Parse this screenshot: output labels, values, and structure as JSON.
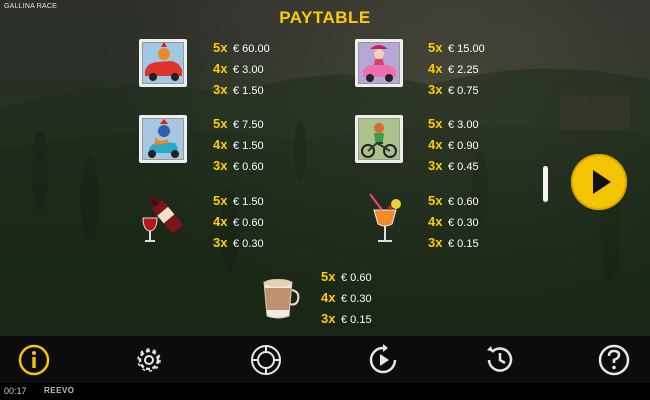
{
  "app": {
    "title": "GALLINA RACE"
  },
  "paytable": {
    "title": "PAYTABLE",
    "symbols": [
      {
        "name": "rooster-car",
        "payouts": [
          {
            "mult": "5x",
            "amount": "€ 60.00"
          },
          {
            "mult": "4x",
            "amount": "€ 3.00"
          },
          {
            "mult": "3x",
            "amount": "€ 1.50"
          }
        ]
      },
      {
        "name": "hen-pink-car",
        "payouts": [
          {
            "mult": "5x",
            "amount": "€ 15.00"
          },
          {
            "mult": "4x",
            "amount": "€ 2.25"
          },
          {
            "mult": "3x",
            "amount": "€ 0.75"
          }
        ]
      },
      {
        "name": "rooster-scooter",
        "payouts": [
          {
            "mult": "5x",
            "amount": "€ 7.50"
          },
          {
            "mult": "4x",
            "amount": "€ 1.50"
          },
          {
            "mult": "3x",
            "amount": "€ 0.60"
          }
        ]
      },
      {
        "name": "hen-bicycle",
        "payouts": [
          {
            "mult": "5x",
            "amount": "€ 3.00"
          },
          {
            "mult": "4x",
            "amount": "€ 0.90"
          },
          {
            "mult": "3x",
            "amount": "€ 0.45"
          }
        ]
      },
      {
        "name": "wine",
        "payouts": [
          {
            "mult": "5x",
            "amount": "€ 1.50"
          },
          {
            "mult": "4x",
            "amount": "€ 0.60"
          },
          {
            "mult": "3x",
            "amount": "€ 0.30"
          }
        ]
      },
      {
        "name": "cocktail",
        "payouts": [
          {
            "mult": "5x",
            "amount": "€ 0.60"
          },
          {
            "mult": "4x",
            "amount": "€ 0.30"
          },
          {
            "mult": "3x",
            "amount": "€ 0.15"
          }
        ]
      },
      {
        "name": "cappuccino",
        "payouts": [
          {
            "mult": "5x",
            "amount": "€ 0.60"
          },
          {
            "mult": "4x",
            "amount": "€ 0.30"
          },
          {
            "mult": "3x",
            "amount": "€ 0.15"
          }
        ]
      }
    ]
  },
  "nav": {
    "items": [
      {
        "name": "info",
        "icon": "info-icon",
        "active": true
      },
      {
        "name": "settings",
        "icon": "gear-icon",
        "active": false
      },
      {
        "name": "bet",
        "icon": "chip-icon",
        "active": false
      },
      {
        "name": "autoplay",
        "icon": "autoplay-icon",
        "active": false
      },
      {
        "name": "history",
        "icon": "history-icon",
        "active": false
      },
      {
        "name": "help",
        "icon": "help-icon",
        "active": false
      }
    ]
  },
  "status": {
    "clock": "00:17",
    "brand": "REEVO"
  },
  "colors": {
    "accent": "#ffcc00",
    "play": "#f5c400",
    "background": "#1e2a1a"
  }
}
